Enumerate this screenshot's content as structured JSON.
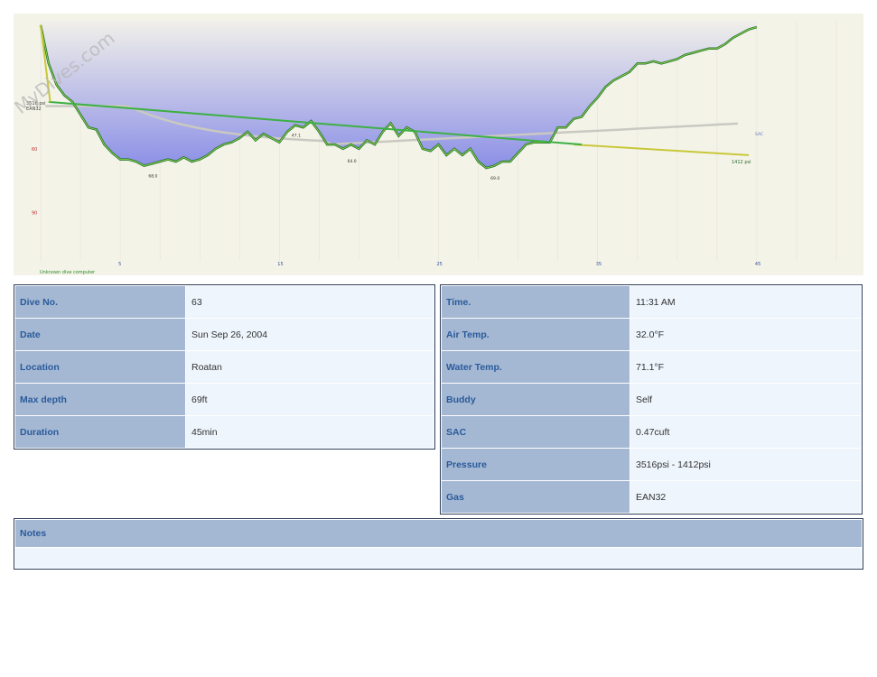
{
  "watermark": "MyDives.com",
  "profile": {
    "computer_label": "Unknown dive computer",
    "start_pressure_label": "3516 psi",
    "start_gas_label": "EAN32",
    "end_pressure_label": "1412 psi",
    "sac_line_label": "SAC",
    "depth_ticks": [
      "60",
      "90"
    ],
    "time_ticks": [
      "5",
      "15",
      "25",
      "35",
      "45"
    ],
    "depth_markers": [
      "68.0",
      "47.1",
      "64.0",
      "69.0"
    ],
    "colors": {
      "depth_line": "#1e6b2e",
      "depth_fill": "#8b8fe6",
      "pressure_line": "#c8c83a",
      "start_line": "#3cb043",
      "background": "#f4f3e8"
    }
  },
  "chart_data": {
    "type": "area",
    "title": "",
    "xlabel": "",
    "ylabel": "",
    "xlim": [
      0,
      50
    ],
    "ylim": [
      0,
      110
    ],
    "series": [
      {
        "values_x": [
          0,
          0.5,
          1,
          1.5,
          2,
          2.5,
          3,
          3.5,
          4,
          4.5,
          5,
          5.5,
          6,
          6.5,
          7,
          7.5,
          8,
          8.5,
          9,
          9.5,
          10,
          10.5,
          11,
          11.5,
          12,
          12.5,
          13,
          13.5,
          14,
          14.5,
          15,
          15.5,
          16,
          16.5,
          17,
          17.5,
          18,
          18.5,
          19,
          19.5,
          20,
          20.5,
          21,
          21.5,
          22,
          22.5,
          23,
          23.5,
          24,
          24.5,
          25,
          25.5,
          26,
          26.5,
          27,
          27.5,
          28,
          28.5,
          29,
          29.5,
          30,
          30.5,
          31,
          31.5,
          32,
          32.5,
          33,
          33.5,
          34,
          34.5,
          35,
          35.5,
          36,
          36.5,
          37,
          37.5,
          38,
          38.5,
          39,
          39.5,
          40,
          40.5,
          41,
          41.5,
          42,
          42.5,
          43,
          43.5,
          44,
          44.5,
          45
        ],
        "values": [
          2,
          20,
          30,
          35,
          38,
          44,
          50,
          51,
          58,
          62,
          65,
          65,
          66,
          68,
          67,
          66,
          65,
          66,
          64,
          66,
          65,
          63,
          60,
          58,
          57,
          55,
          52,
          56,
          53,
          55,
          57,
          52,
          49,
          50,
          47,
          52,
          58,
          58,
          60,
          58,
          60,
          56,
          58,
          52,
          48,
          54,
          50,
          52,
          60,
          61,
          58,
          63,
          60,
          63,
          60,
          66,
          69,
          68,
          66,
          66,
          62,
          58,
          57,
          57,
          57,
          50,
          50,
          46,
          45,
          40,
          36,
          31,
          28,
          26,
          24,
          20,
          20,
          19,
          20,
          19,
          18,
          16,
          15,
          14,
          13,
          13,
          11,
          8,
          6,
          4,
          3,
          2,
          1,
          0.5,
          0
        ]
      }
    ],
    "pressure": {
      "start_psi": 3516,
      "end_psi": 1412,
      "gas": "EAN32"
    }
  },
  "dive": {
    "left": [
      {
        "label": "Dive No.",
        "value": "63"
      },
      {
        "label": "Date",
        "value": "Sun Sep 26, 2004"
      },
      {
        "label": "Location",
        "value": "Roatan"
      },
      {
        "label": "Max depth",
        "value": "69ft"
      },
      {
        "label": "Duration",
        "value": "45min"
      }
    ],
    "right": [
      {
        "label": "Time.",
        "value": "11:31 AM"
      },
      {
        "label": "Air Temp.",
        "value": "32.0°F"
      },
      {
        "label": "Water Temp.",
        "value": "71.1°F"
      },
      {
        "label": "Buddy",
        "value": "Self"
      },
      {
        "label": "SAC",
        "value": "0.47cuft"
      },
      {
        "label": "Pressure",
        "value": "3516psi - 1412psi"
      },
      {
        "label": "Gas",
        "value": "EAN32"
      }
    ],
    "notes": {
      "label": "Notes",
      "value": ""
    }
  }
}
